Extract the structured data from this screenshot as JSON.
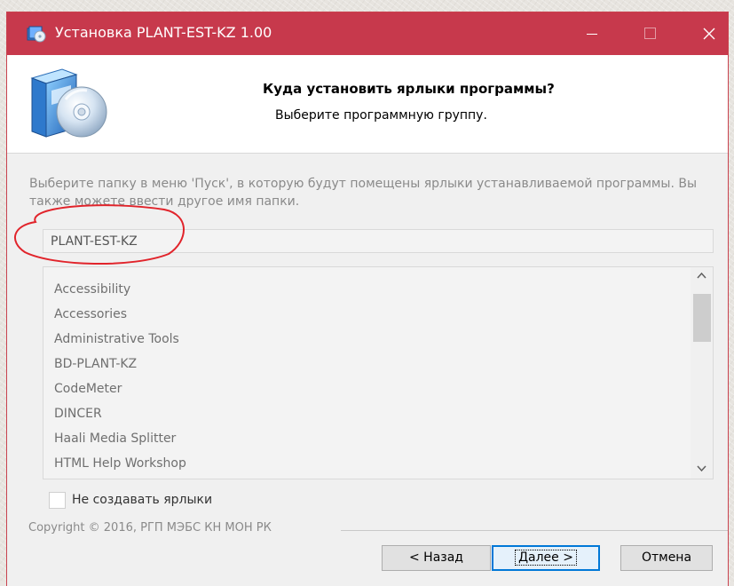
{
  "window": {
    "title": "Установка PLANT-EST-KZ 1.00",
    "accent_color": "#c7394c"
  },
  "header": {
    "title": "Куда установить ярлыки программы?",
    "subtitle": "Выберите программную группу.",
    "icon": "installer-box-cd-icon"
  },
  "body": {
    "description": "Выберите папку в меню 'Пуск', в которую будут помещены ярлыки устанавливаемой программы. Вы также можете ввести другое имя папки.",
    "folder_value": "PLANT-EST-KZ",
    "folder_list": [
      "Accessibility",
      "Accessories",
      "Administrative Tools",
      "BD-PLANT-KZ",
      "CodeMeter",
      "DINCER",
      "Haali Media Splitter",
      "HTML Help Workshop"
    ],
    "no_shortcuts_label": "Не создавать ярлыки",
    "no_shortcuts_checked": false
  },
  "footer": {
    "copyright": "Copyright © 2016, РГП МЭБС КН МОН РК",
    "back_label": "< Назад",
    "next_label": "Далее >",
    "cancel_label": "Отмена"
  }
}
